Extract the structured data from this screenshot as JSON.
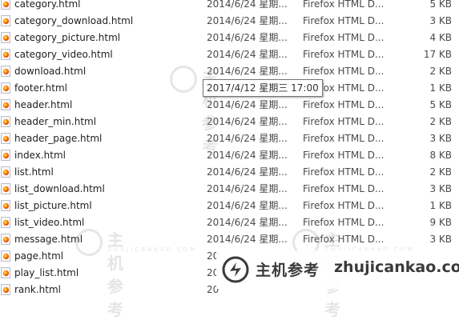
{
  "files": [
    {
      "name": "category.html",
      "date": "2014/6/24 星期...",
      "type": "Firefox HTML D...",
      "size": "5 KB"
    },
    {
      "name": "category_download.html",
      "date": "2014/6/24 星期...",
      "type": "Firefox HTML D...",
      "size": "3 KB"
    },
    {
      "name": "category_picture.html",
      "date": "2014/6/24 星期...",
      "type": "Firefox HTML D...",
      "size": "4 KB"
    },
    {
      "name": "category_video.html",
      "date": "2014/6/24 星期...",
      "type": "Firefox HTML D...",
      "size": "17 KB"
    },
    {
      "name": "download.html",
      "date": "2014/6/24 星期...",
      "type": "Firefox HTML D...",
      "size": "2 KB"
    },
    {
      "name": "footer.html",
      "date": "",
      "type": "Firefox HTML D...",
      "size": "1 KB"
    },
    {
      "name": "header.html",
      "date": "2014/6/24 星期...",
      "type": "Firefox HTML D...",
      "size": "5 KB"
    },
    {
      "name": "header_min.html",
      "date": "2014/6/24 星期...",
      "type": "Firefox HTML D...",
      "size": "2 KB"
    },
    {
      "name": "header_page.html",
      "date": "2014/6/24 星期...",
      "type": "Firefox HTML D...",
      "size": "3 KB"
    },
    {
      "name": "index.html",
      "date": "2014/6/24 星期...",
      "type": "Firefox HTML D...",
      "size": "8 KB"
    },
    {
      "name": "list.html",
      "date": "2014/6/24 星期...",
      "type": "Firefox HTML D...",
      "size": "2 KB"
    },
    {
      "name": "list_download.html",
      "date": "2014/6/24 星期...",
      "type": "Firefox HTML D...",
      "size": "3 KB"
    },
    {
      "name": "list_picture.html",
      "date": "2014/6/24 星期...",
      "type": "Firefox HTML D...",
      "size": "1 KB"
    },
    {
      "name": "list_video.html",
      "date": "2014/6/24 星期...",
      "type": "Firefox HTML D...",
      "size": "9 KB"
    },
    {
      "name": "message.html",
      "date": "2014/6/24 星期...",
      "type": "Firefox HTML D...",
      "size": "3 KB"
    },
    {
      "name": "page.html",
      "date": "20",
      "type": "",
      "size": ""
    },
    {
      "name": "play_list.html",
      "date": "20",
      "type": "",
      "size": ""
    },
    {
      "name": "rank.html",
      "date": "20",
      "type": "",
      "size": ""
    }
  ],
  "tooltip": "2017/4/12 星期三 17:00",
  "watermark": {
    "cn": "主机参考",
    "url": "ZHUJICANKAO.COM"
  },
  "banner": {
    "cn": "主机参考",
    "url": "zhujicankao.com"
  },
  "colors": {
    "text": "#1e1e1e",
    "muted": "#4a4a4a",
    "tooltip_border": "#767676"
  },
  "icons": {
    "file": "firefox-html-file-icon",
    "logo": "zhujicankao-logo-icon"
  }
}
